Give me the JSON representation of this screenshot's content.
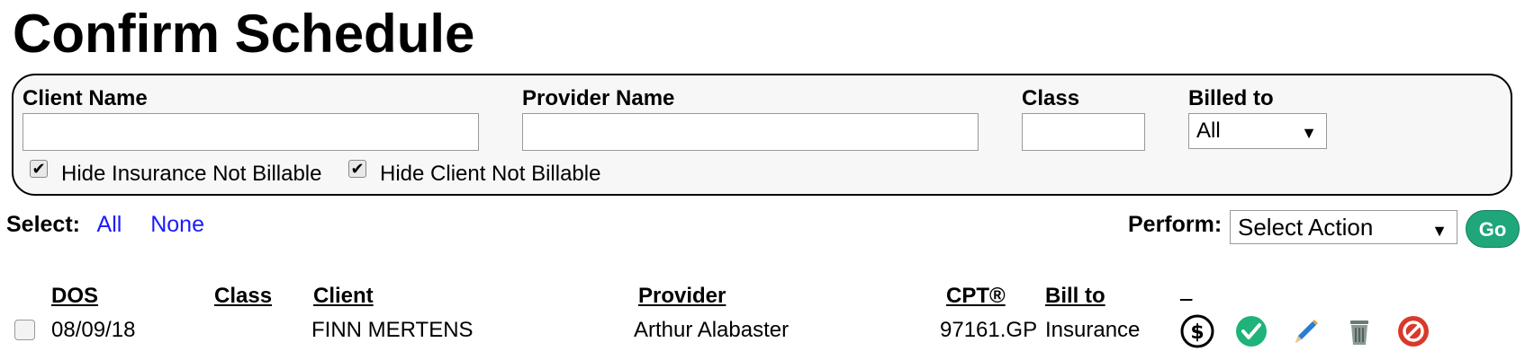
{
  "page": {
    "title": "Confirm Schedule"
  },
  "filters": {
    "client_name_label": "Client Name",
    "client_name_value": "",
    "provider_name_label": "Provider Name",
    "provider_name_value": "",
    "class_label": "Class",
    "class_value": "",
    "billed_to_label": "Billed to",
    "billed_to_value": "All",
    "hide_insurance_label": "Hide Insurance Not Billable",
    "hide_insurance_checked": true,
    "hide_client_label": "Hide Client Not Billable",
    "hide_client_checked": true
  },
  "selection": {
    "label": "Select:",
    "all": "All",
    "none": "None"
  },
  "perform": {
    "label": "Perform:",
    "value": "Select Action",
    "go": "Go"
  },
  "table": {
    "headers": {
      "dos": "DOS",
      "class": "Class",
      "client": "Client",
      "provider": "Provider",
      "cpt": "CPT®",
      "bill_to": "Bill to",
      "actions": "_"
    },
    "rows": [
      {
        "dos": "08/09/18",
        "class": "",
        "client": "FINN MERTENS",
        "provider": "Arthur Alabaster",
        "cpt": "97161.GP",
        "bill_to": "Insurance",
        "icons": [
          "dollar-icon",
          "check-icon",
          "pencil-icon",
          "trash-icon",
          "cancel-icon"
        ]
      }
    ]
  },
  "colors": {
    "go": "#1fa67a",
    "link": "#1a1aff",
    "check_green": "#1fb37a",
    "cancel_red": "#d9392b",
    "pencil_blue": "#2b7cd3"
  }
}
